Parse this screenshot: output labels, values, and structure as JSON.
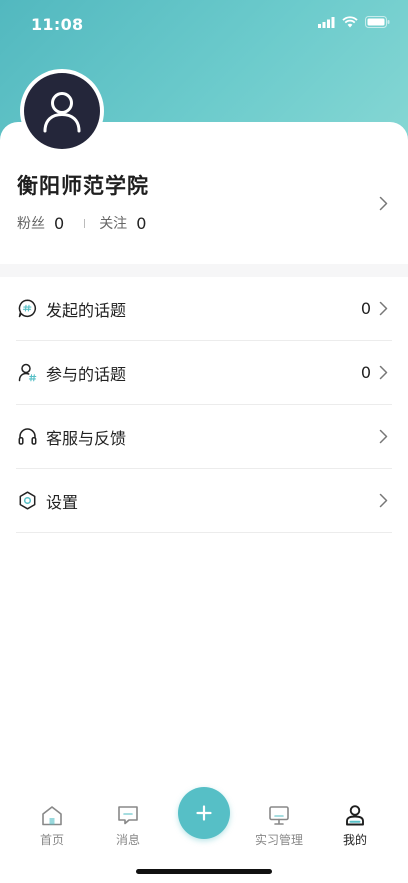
{
  "status_bar": {
    "time": "11:08"
  },
  "profile": {
    "name": "衡阳师范学院",
    "fans_label": "粉丝",
    "fans_count": "0",
    "following_label": "关注",
    "following_count": "0"
  },
  "menu": {
    "items": [
      {
        "label": "发起的话题",
        "count": "0",
        "icon": "chat-bubble-icon"
      },
      {
        "label": "参与的话题",
        "count": "0",
        "icon": "person-tag-icon"
      },
      {
        "label": "客服与反馈",
        "icon": "headphones-icon"
      },
      {
        "label": "设置",
        "icon": "settings-icon"
      }
    ]
  },
  "tabbar": {
    "tabs": [
      {
        "label": "首页",
        "icon": "home-icon"
      },
      {
        "label": "消息",
        "icon": "message-icon"
      },
      {
        "label": "实习管理",
        "icon": "monitor-icon"
      },
      {
        "label": "我的",
        "icon": "profile-icon"
      }
    ],
    "active": "我的",
    "fab_icon": "plus-icon"
  },
  "colors": {
    "accent": "#56bfc6",
    "header_gradient_start": "#52b8bf",
    "avatar_bg": "#24263a"
  }
}
